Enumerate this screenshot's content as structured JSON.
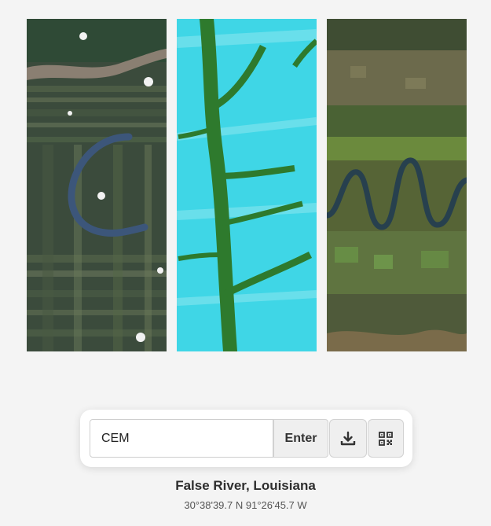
{
  "gallery": {
    "images": [
      {
        "subject": "river-oxbow-farmland-satellite"
      },
      {
        "subject": "river-valley-cyan-snow-satellite"
      },
      {
        "subject": "meandering-river-forest-satellite"
      }
    ]
  },
  "search": {
    "value": "CEM",
    "enter_label": "Enter",
    "download_icon": "download-icon",
    "qr_icon": "qr-code-icon"
  },
  "location": {
    "name": "False River, Louisiana",
    "coordinates": "30°38'39.7 N 91°26'45.7 W"
  },
  "colors": {
    "background": "#f4f4f4",
    "card": "#ffffff",
    "button": "#efefef"
  }
}
